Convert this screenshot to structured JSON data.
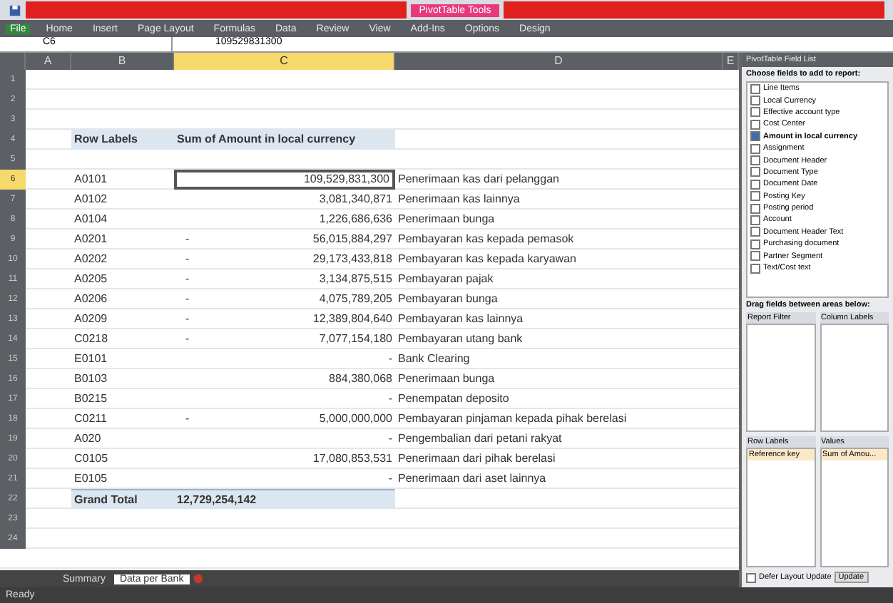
{
  "title_bar": {
    "context_tab": "PivotTable Tools"
  },
  "ribbon_tabs": [
    {
      "label": "File",
      "selected": true
    },
    {
      "label": "Home",
      "selected": false
    },
    {
      "label": "Insert",
      "selected": false
    },
    {
      "label": "Page Layout",
      "selected": false
    },
    {
      "label": "Formulas",
      "selected": false
    },
    {
      "label": "Data",
      "selected": false
    },
    {
      "label": "Review",
      "selected": false
    },
    {
      "label": "View",
      "selected": false
    },
    {
      "label": "Add-Ins",
      "selected": false
    },
    {
      "label": "Options",
      "selected": false
    },
    {
      "label": "Design",
      "selected": false
    }
  ],
  "formula_bar": {
    "name_box": "C6",
    "formula": "109529831300"
  },
  "row_headers": [
    {
      "label": "1",
      "selected": false
    },
    {
      "label": "2",
      "selected": false
    },
    {
      "label": "3",
      "selected": false
    },
    {
      "label": "4",
      "selected": false
    },
    {
      "label": "5",
      "selected": false
    },
    {
      "label": "6",
      "selected": true
    },
    {
      "label": "7",
      "selected": false
    },
    {
      "label": "8",
      "selected": false
    },
    {
      "label": "9",
      "selected": false
    },
    {
      "label": "10",
      "selected": false
    },
    {
      "label": "11",
      "selected": false
    },
    {
      "label": "12",
      "selected": false
    },
    {
      "label": "13",
      "selected": false
    },
    {
      "label": "14",
      "selected": false
    },
    {
      "label": "15",
      "selected": false
    },
    {
      "label": "16",
      "selected": false
    },
    {
      "label": "17",
      "selected": false
    },
    {
      "label": "18",
      "selected": false
    },
    {
      "label": "19",
      "selected": false
    },
    {
      "label": "20",
      "selected": false
    },
    {
      "label": "21",
      "selected": false
    },
    {
      "label": "22",
      "selected": false
    },
    {
      "label": "23",
      "selected": false
    },
    {
      "label": "24",
      "selected": false
    }
  ],
  "columns": [
    {
      "label": "A",
      "selected": false
    },
    {
      "label": "B",
      "selected": false
    },
    {
      "label": "C",
      "selected": true
    },
    {
      "label": "D",
      "selected": false
    },
    {
      "label": "E",
      "selected": false
    }
  ],
  "pivot": {
    "row_labels": "Row Labels",
    "value_label": "Sum of Amount in local currency",
    "rows": [
      {
        "code": "A0101",
        "amount": "109,529,831,300",
        "description": "Penerimaan kas dari pelanggan"
      },
      {
        "code": "A0102",
        "amount": "3,081,340,871",
        "description": "Penerimaan kas lainnya"
      },
      {
        "code": "A0104",
        "amount": "1,226,686,636",
        "description": "Penerimaan bunga"
      },
      {
        "code": "A0201",
        "column_2": "-",
        "amount": "56,015,884,297",
        "description": "Pembayaran kas kepada pemasok"
      },
      {
        "code": "A0202",
        "column_2": "-",
        "amount": "29,173,433,818",
        "description": "Pembayaran kas kepada karyawan"
      },
      {
        "code": "A0205",
        "column_2": "-",
        "amount": "3,134,875,515",
        "description": "Pembayaran pajak"
      },
      {
        "code": "A0206",
        "column_2": "-",
        "amount": "4,075,789,205",
        "description": "Pembayaran bunga"
      },
      {
        "code": "A0209",
        "column_2": "-",
        "amount": "12,389,804,640",
        "description": "Pembayaran kas lainnya"
      },
      {
        "code": "C0218",
        "column_2": "-",
        "amount": "7,077,154,180",
        "description": "Pembayaran utang bank"
      },
      {
        "code": "E0101",
        "amount": "-",
        "description": "Bank Clearing"
      },
      {
        "code": "B0103",
        "amount": "884,380,068",
        "description": "Penerimaan bunga"
      },
      {
        "code": "B0215",
        "amount": "-",
        "description": "Penempatan deposito"
      },
      {
        "code": "C0211",
        "column_2": "-",
        "amount": "5,000,000,000",
        "description": "Pembayaran pinjaman kepada pihak berelasi"
      },
      {
        "code": "A020",
        "amount": "-",
        "description": "Pengembalian dari petani rakyat"
      },
      {
        "code": "C0105",
        "amount": "17,080,853,531",
        "description": "Penerimaan dari pihak berelasi"
      },
      {
        "code": "E0105",
        "amount": "-",
        "description": "Penerimaan dari aset lainnya"
      }
    ],
    "grand_total": {
      "label": "Grand Total",
      "amount": "12,729,254,142"
    }
  },
  "sheet_tabs": [
    {
      "label": "Summary",
      "selected": false
    },
    {
      "label": "Data per Bank",
      "selected": true
    }
  ],
  "status_bar": {
    "text": "Ready"
  },
  "field_list": {
    "title": "PivotTable Field List",
    "choose_label": "Choose fields to add to report:",
    "fields": [
      {
        "label": "Line Items",
        "checked": false
      },
      {
        "label": "Local Currency",
        "checked": false
      },
      {
        "label": "Effective account type",
        "checked": false
      },
      {
        "label": "Cost Center",
        "checked": false
      },
      {
        "label": "Amount in local currency",
        "checked": true
      },
      {
        "label": "Assignment",
        "checked": false
      },
      {
        "label": "Document Header",
        "checked": false
      },
      {
        "label": "Document Type",
        "checked": false
      },
      {
        "label": "Document Date",
        "checked": false
      },
      {
        "label": "Posting Key",
        "checked": false
      },
      {
        "label": "Posting period",
        "checked": false
      },
      {
        "label": "Account",
        "checked": false
      },
      {
        "label": "Document Header Text",
        "checked": false
      },
      {
        "label": "Purchasing document",
        "checked": false
      },
      {
        "label": "Partner Segment",
        "checked": false
      },
      {
        "label": "Text/Cost text",
        "checked": false
      }
    ],
    "drag_label": "Drag fields between areas below:",
    "areas": [
      {
        "label": "Report Filter"
      },
      {
        "label": "Column Labels"
      },
      {
        "label": "Row Labels",
        "items": [
          "Reference key"
        ]
      },
      {
        "label": "Values",
        "items": [
          "Sum of Amou..."
        ]
      }
    ],
    "defer_checked": false,
    "defer_label": "Defer Layout Update",
    "update_button": "Update"
  }
}
